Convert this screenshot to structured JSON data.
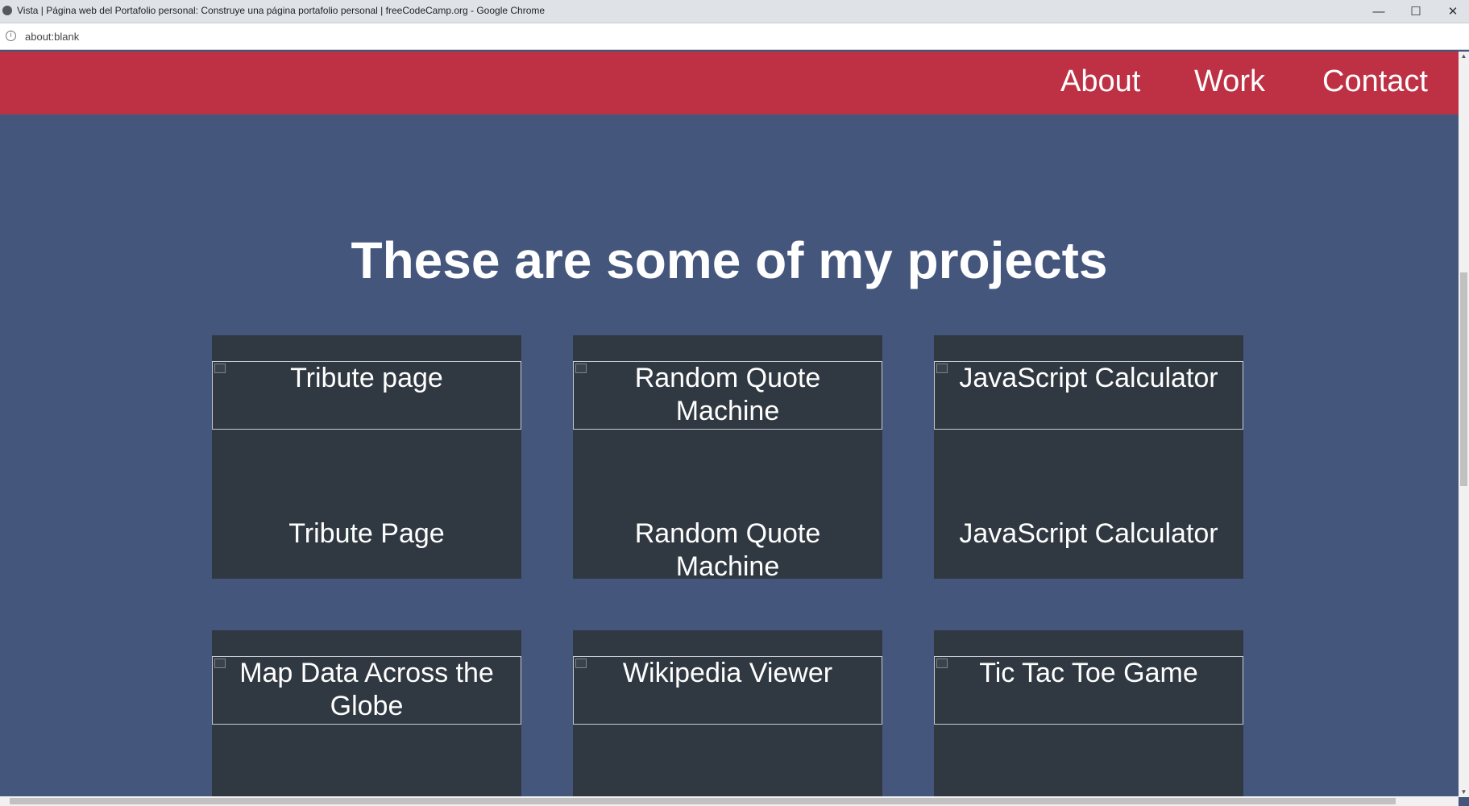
{
  "window": {
    "title": "Vista | Página web del Portafolio personal: Construye una página portafolio personal | freeCodeCamp.org - Google Chrome",
    "minimize": "—",
    "maximize": "☐",
    "close": "✕"
  },
  "address": {
    "info_icon": "i",
    "url": "about:blank"
  },
  "nav": {
    "about": "About",
    "work": "Work",
    "contact": "Contact"
  },
  "projects": {
    "heading": "These are some of my projects",
    "items": [
      {
        "image_alt": "Tribute page",
        "caption": "Tribute Page"
      },
      {
        "image_alt": "Random Quote Machine",
        "caption": "Random Quote Machine"
      },
      {
        "image_alt": "JavaScript Calculator",
        "caption": "JavaScript Calculator"
      },
      {
        "image_alt": "Map Data Across the Globe",
        "caption": ""
      },
      {
        "image_alt": "Wikipedia Viewer",
        "caption": ""
      },
      {
        "image_alt": "Tic Tac Toe Game",
        "caption": ""
      }
    ]
  },
  "colors": {
    "nav_background": "#be3144",
    "page_background": "#45567d",
    "card_background": "#303841"
  }
}
